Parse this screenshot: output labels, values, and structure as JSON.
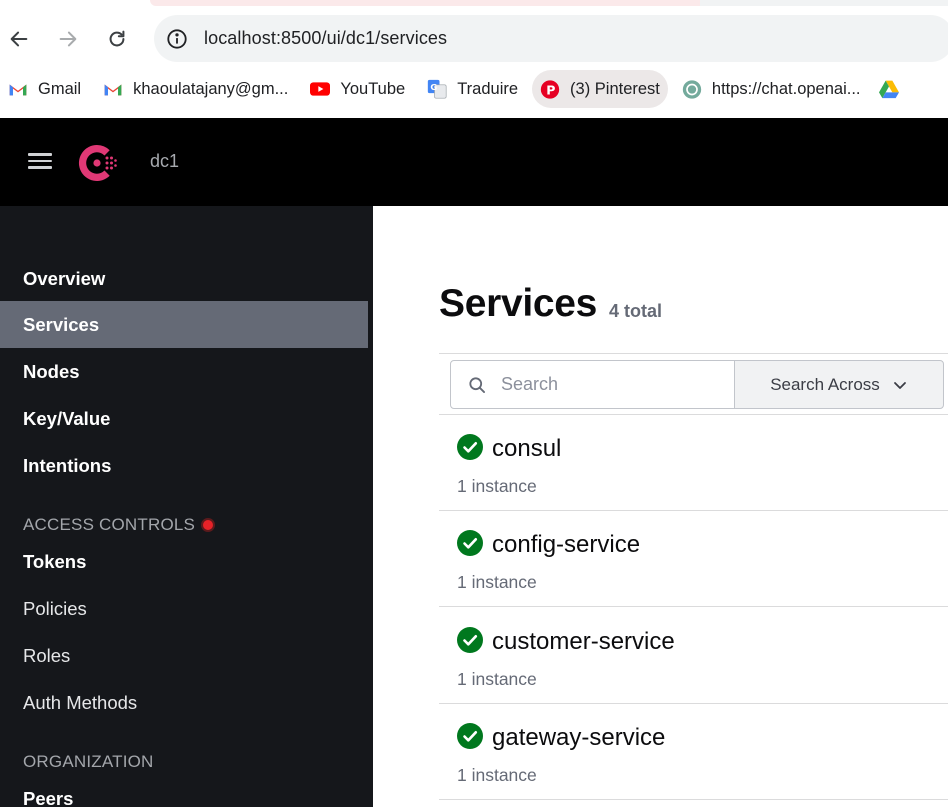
{
  "browser": {
    "url": "localhost:8500/ui/dc1/services",
    "bookmarks": [
      {
        "label": "Gmail",
        "icon": "gmail-icon"
      },
      {
        "label": "khaoulatajany@gm...",
        "icon": "gmail-icon"
      },
      {
        "label": "YouTube",
        "icon": "youtube-icon"
      },
      {
        "label": "Traduire",
        "icon": "translate-icon"
      },
      {
        "label": "(3) Pinterest",
        "icon": "pinterest-icon"
      },
      {
        "label": "https://chat.openai...",
        "icon": "openai-icon"
      }
    ]
  },
  "header": {
    "datacenter": "dc1"
  },
  "sidebar": {
    "items": [
      {
        "label": "Overview"
      },
      {
        "label": "Services"
      },
      {
        "label": "Nodes"
      },
      {
        "label": "Key/Value"
      },
      {
        "label": "Intentions"
      }
    ],
    "access_controls": {
      "title": "ACCESS CONTROLS",
      "items": [
        {
          "label": "Tokens"
        },
        {
          "label": "Policies"
        },
        {
          "label": "Roles"
        },
        {
          "label": "Auth Methods"
        }
      ]
    },
    "organization": {
      "title": "ORGANIZATION",
      "items": [
        {
          "label": "Peers"
        }
      ]
    }
  },
  "main": {
    "title": "Services",
    "count": "4 total",
    "search": {
      "placeholder": "Search",
      "across_label": "Search Across"
    },
    "services": [
      {
        "name": "consul",
        "instances": "1 instance",
        "status": "passing"
      },
      {
        "name": "config-service",
        "instances": "1 instance",
        "status": "passing"
      },
      {
        "name": "customer-service",
        "instances": "1 instance",
        "status": "passing"
      },
      {
        "name": "gateway-service",
        "instances": "1 instance",
        "status": "passing"
      }
    ]
  },
  "colors": {
    "consul_brand": "#e03875",
    "passing": "#00781e",
    "sidebar_bg": "#15171b",
    "sidebar_selected": "#656a76"
  }
}
